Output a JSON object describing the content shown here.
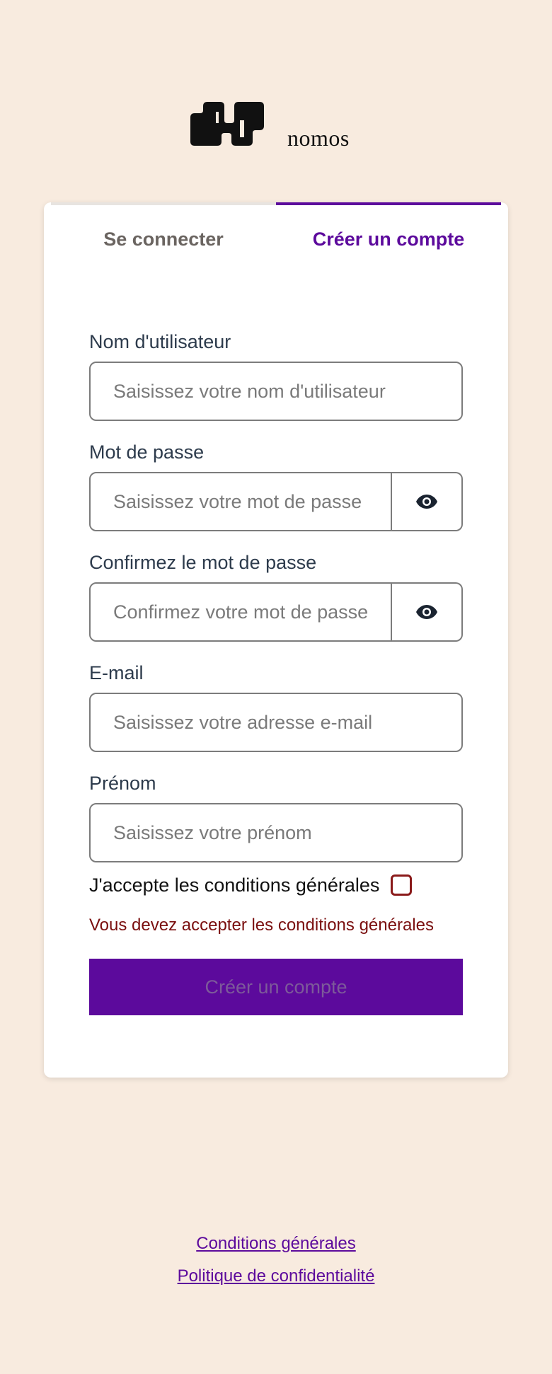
{
  "brand": {
    "name": "nomos",
    "logo_icon": "nomos-logo-icon"
  },
  "tabs": [
    {
      "label": "Se connecter",
      "active": false
    },
    {
      "label": "Créer un compte",
      "active": true
    }
  ],
  "form": {
    "username": {
      "label": "Nom d'utilisateur",
      "placeholder": "Saisissez votre nom d'utilisateur",
      "value": ""
    },
    "password": {
      "label": "Mot de passe",
      "placeholder": "Saisissez votre mot de passe",
      "value": "",
      "toggle_icon": "eye-icon"
    },
    "confirm_password": {
      "label": "Confirmez le mot de passe",
      "placeholder": "Confirmez votre mot de passe",
      "value": "",
      "toggle_icon": "eye-icon"
    },
    "email": {
      "label": "E-mail",
      "placeholder": "Saisissez votre adresse e-mail",
      "value": ""
    },
    "first_name": {
      "label": "Prénom",
      "placeholder": "Saisissez votre prénom",
      "value": ""
    },
    "terms": {
      "label": "J'accepte les conditions générales",
      "checked": false,
      "error": "Vous devez accepter les conditions générales"
    },
    "submit_label": "Créer un compte"
  },
  "footer": {
    "terms_link": "Conditions générales",
    "privacy_link": "Politique de confidentialité"
  },
  "colors": {
    "background": "#f8ebdf",
    "accent": "#5c0a9c",
    "error": "#7a0f0f"
  }
}
